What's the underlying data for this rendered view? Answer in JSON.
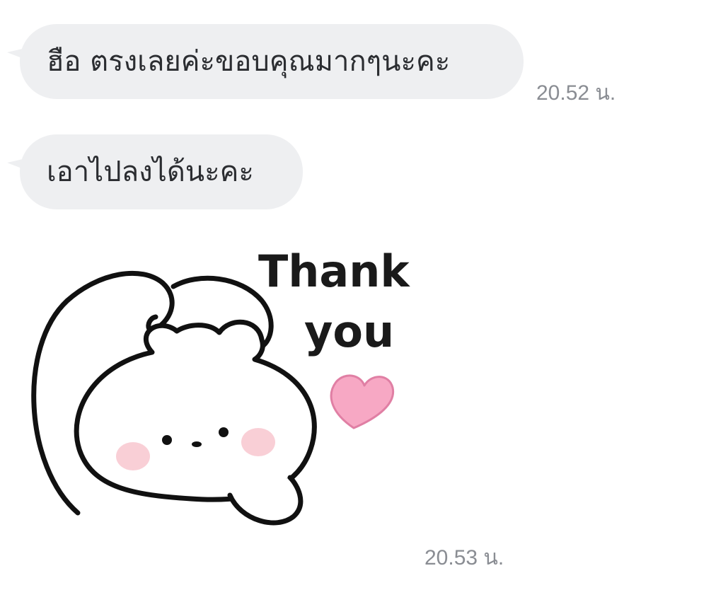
{
  "messages": [
    {
      "text": "ฮือ ตรงเลยค่ะขอบคุณมากๆนะคะ",
      "time": "20.52 น."
    },
    {
      "text": "เอาไปลงได้นะคะ"
    }
  ],
  "sticker": {
    "text_line1": "Thank",
    "text_line2": "you",
    "icon": "bear-thank-you-sticker",
    "heart_color": "#f7a8c4",
    "time": "20.53 น."
  },
  "colors": {
    "bubble": "#eeeff1",
    "text": "#2b2d31",
    "timestamp": "#8a8d93"
  }
}
